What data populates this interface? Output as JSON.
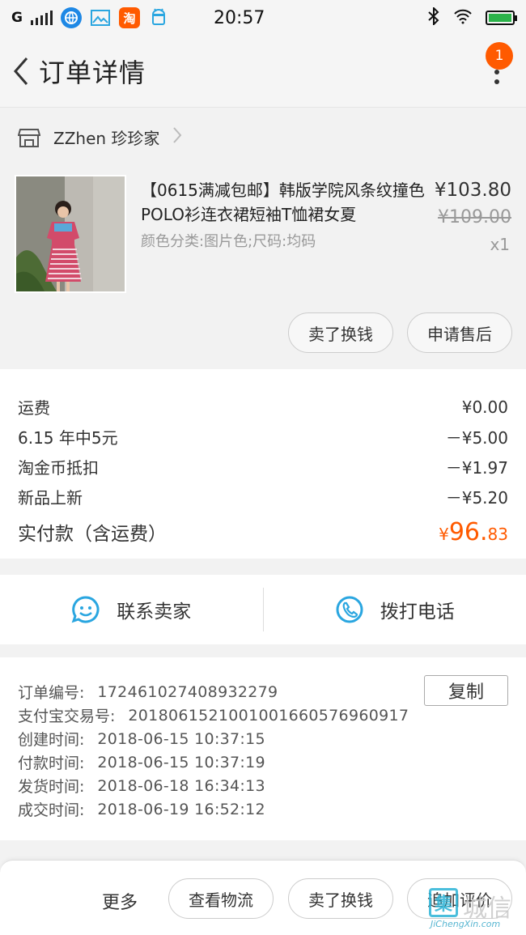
{
  "status_bar": {
    "carrier": "G",
    "time": "20:57",
    "icons": [
      "signal-icon",
      "browser-icon",
      "gallery-icon",
      "taobao-icon",
      "android-icon",
      "bluetooth-icon",
      "wifi-icon",
      "battery-icon"
    ],
    "taobao_label": "淘"
  },
  "header": {
    "title": "订单详情",
    "badge_count": "1"
  },
  "shop": {
    "name": "ZZhen 珍珍家"
  },
  "product": {
    "title": "【0615满减包邮】韩版学院风条纹撞色POLO衫连衣裙短袖T恤裙女夏",
    "spec": "颜色分类:图片色;尺码:均码",
    "price": "¥103.80",
    "original_price": "¥109.00",
    "quantity": "x1",
    "actions": [
      "卖了换钱",
      "申请售后"
    ]
  },
  "fees": {
    "rows": [
      {
        "label": "运费",
        "value": "¥0.00"
      },
      {
        "label": "6.15 年中5元",
        "value": "－¥5.00"
      },
      {
        "label": "淘金币抵扣",
        "value": "－¥1.97"
      },
      {
        "label": "新品上新",
        "value": "－¥5.20"
      }
    ],
    "total_label": "实付款（含运费）",
    "total_currency": "¥",
    "total_int": "96.",
    "total_dec": "83"
  },
  "contact": {
    "seller": "联系卖家",
    "phone": "拨打电话"
  },
  "order_info": {
    "copy_label": "复制",
    "rows": [
      {
        "label": "订单编号:",
        "value": "172461027408932279"
      },
      {
        "label": "支付宝交易号:",
        "value": "2018061521001001660576960917"
      },
      {
        "label": "创建时间:",
        "value": "2018-06-15 10:37:15"
      },
      {
        "label": "付款时间:",
        "value": "2018-06-15 10:37:19"
      },
      {
        "label": "发货时间:",
        "value": "2018-06-18 16:34:13"
      },
      {
        "label": "成交时间:",
        "value": "2018-06-19 16:52:12"
      }
    ]
  },
  "bottom_bar": {
    "more": "更多",
    "buttons": [
      "查看物流",
      "卖了换钱",
      "追加评价"
    ]
  },
  "watermark": {
    "text": "城信",
    "sub": "JiChengXin.com",
    "glyph": "集"
  },
  "colors": {
    "accent": "#ff5a00",
    "contact_blue": "#2aa6e0"
  }
}
